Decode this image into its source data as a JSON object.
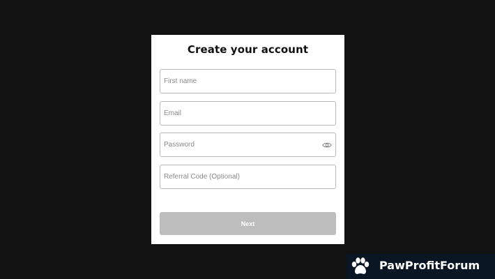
{
  "form": {
    "title": "Create your account",
    "fields": [
      {
        "placeholder": "First name",
        "value": ""
      },
      {
        "placeholder": "Email",
        "value": ""
      },
      {
        "placeholder": "Password",
        "value": ""
      },
      {
        "placeholder": "Referral Code (Optional)",
        "value": ""
      }
    ],
    "next_label": "Next",
    "password_toggle_icon": "eye-icon"
  },
  "watermark": {
    "text": "PawProfitForum",
    "icon": "paw-icon",
    "background": "#0b1624"
  },
  "colors": {
    "page_background": "#121212",
    "card_background": "#ffffff",
    "button_disabled": "#bdbdbd"
  }
}
